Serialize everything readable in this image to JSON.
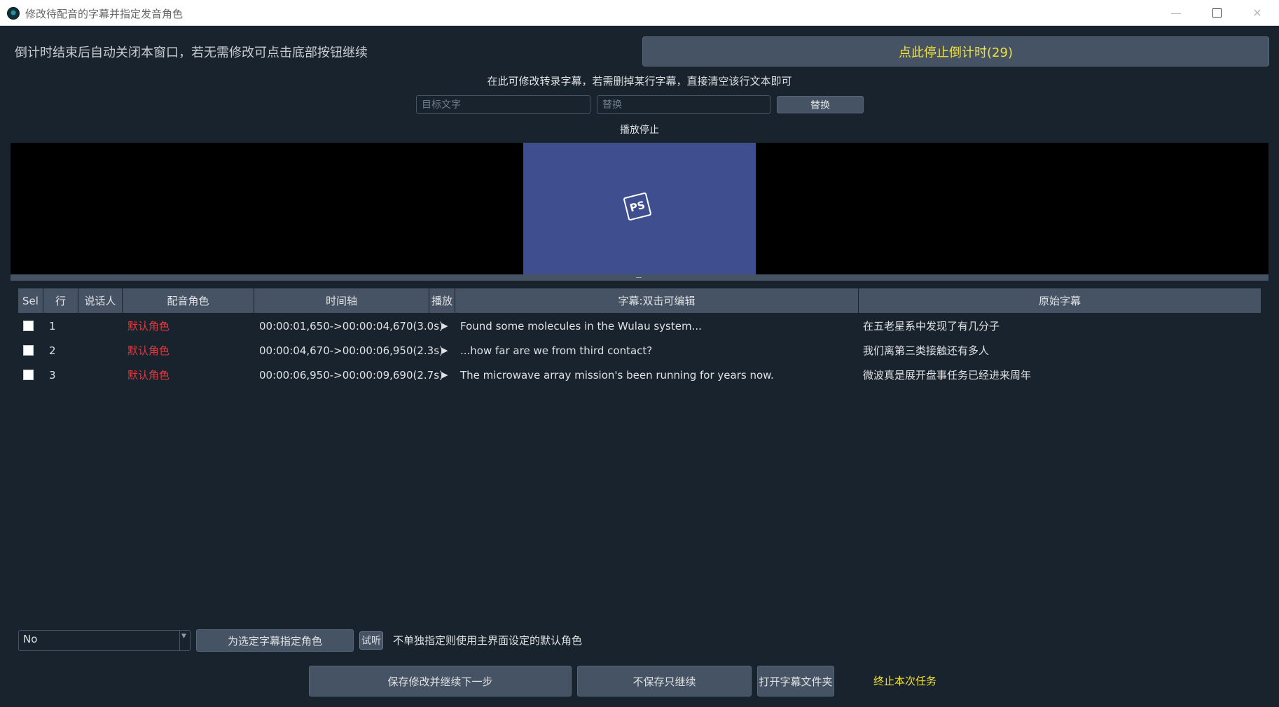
{
  "window": {
    "title": "修改待配音的字幕并指定发音角色",
    "minimize_glyph": "—",
    "close_glyph": "✕"
  },
  "countdown": {
    "note": "倒计时结束后自动关闭本窗口，若无需修改可点击底部按钮继续",
    "stop_button": "点此停止倒计时(29)"
  },
  "edit_hint": "在此可修改转录字幕，若需删掉某行字幕，直接清空该行文本即可",
  "replace": {
    "target_placeholder": "目标文字",
    "replace_placeholder": "替换",
    "button": "替换"
  },
  "player": {
    "status": "播放停止",
    "logo_text": "PS"
  },
  "table": {
    "columns": [
      "Sel",
      "行",
      "说话人",
      "配音角色",
      "时间轴",
      "播放",
      "字幕:双击可编辑",
      "原始字幕"
    ],
    "play_glyph": "▶",
    "rows": [
      {
        "line": "1",
        "speaker": "",
        "role": "默认角色",
        "time": "00:00:01,650->00:00:04,670(3.0s)",
        "subtitle": "Found some molecules in the Wulau system...",
        "original": "在五老星系中发现了有几分子"
      },
      {
        "line": "2",
        "speaker": "",
        "role": "默认角色",
        "time": "00:00:04,670->00:00:06,950(2.3s)",
        "subtitle": "...how far are we from third contact?",
        "original": "我们离第三类接触还有多人"
      },
      {
        "line": "3",
        "speaker": "",
        "role": "默认角色",
        "time": "00:00:06,950->00:00:09,690(2.7s)",
        "subtitle": "The microwave array mission's been running for years now.",
        "original": "微波真是展开盘事任务已经进来周年"
      }
    ]
  },
  "role_select": {
    "value": "No",
    "assign_button": "为选定字幕指定角色",
    "audition_button": "试听",
    "note": "不单独指定则使用主界面设定的默认角色"
  },
  "actions": {
    "save_continue": "保存修改并继续下一步",
    "continue_no_save": "不保存只继续",
    "open_folder": "打开字幕文件夹",
    "abort": "终止本次任务"
  },
  "colors": {
    "background": "#19232d",
    "button": "#455364",
    "accent_yellow": "#f0e13c",
    "role_red": "#e0393e",
    "video_frame": "#3f4e8f"
  }
}
